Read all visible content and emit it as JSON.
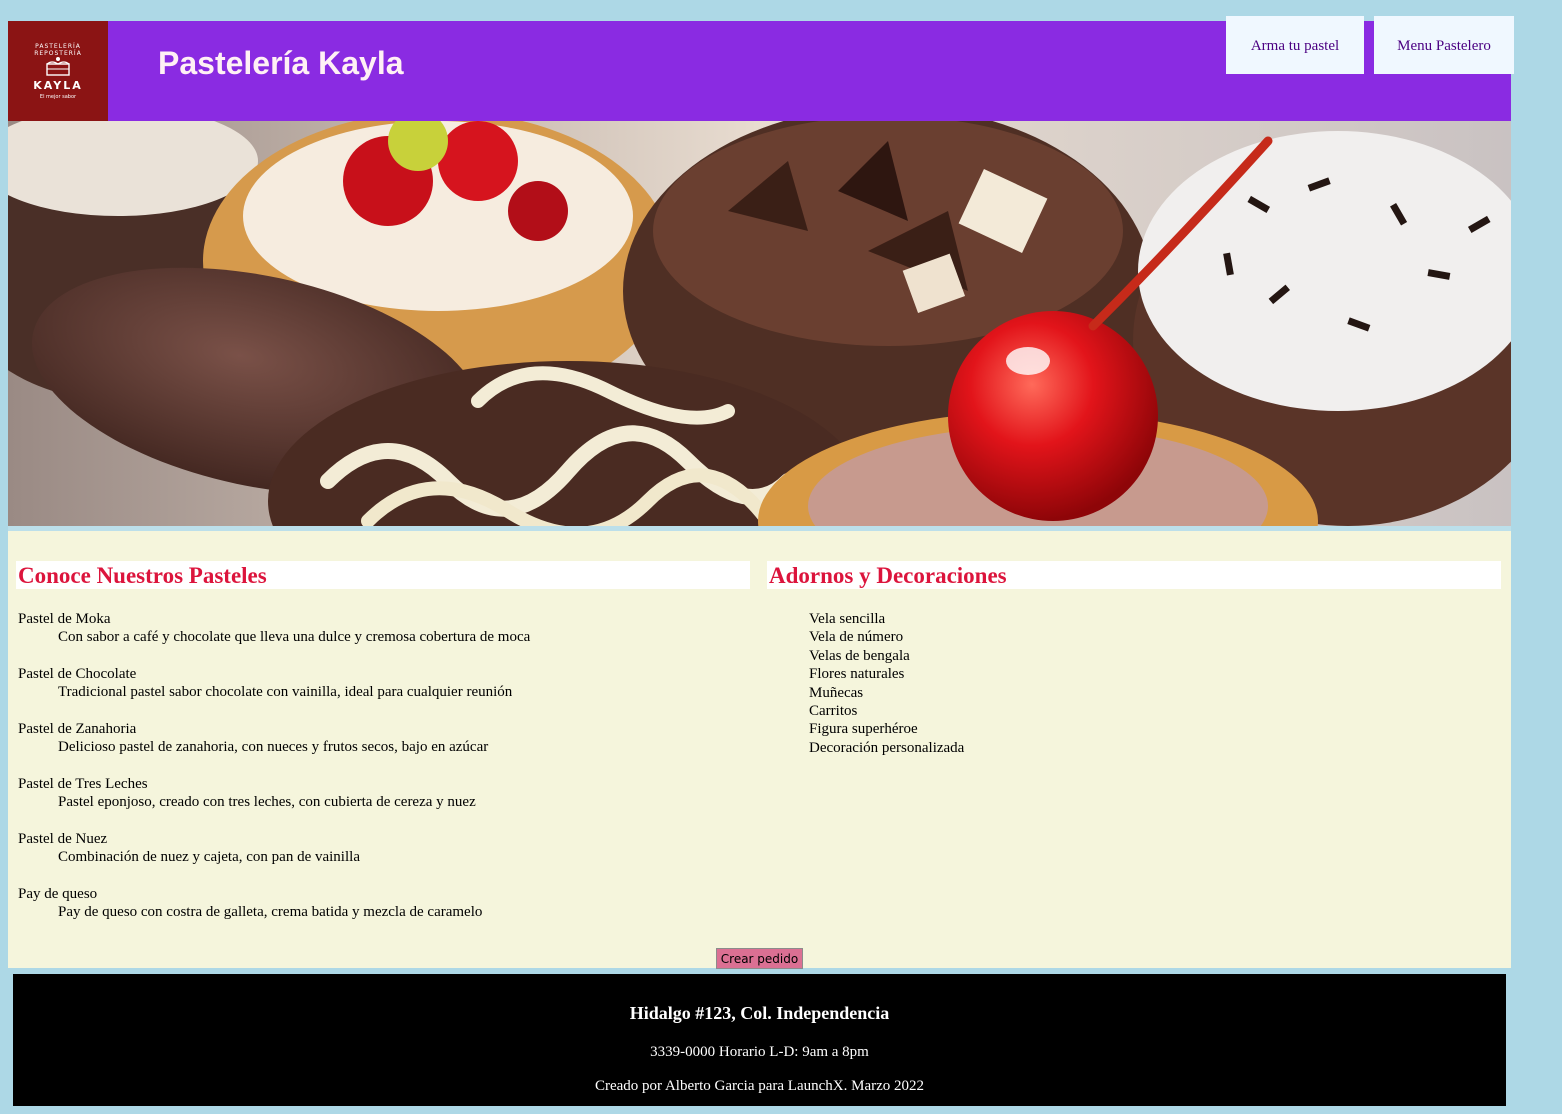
{
  "header": {
    "title": "Pastelería Kayla",
    "logo": {
      "arc_text": "PASTELERÍA REPOSTERÍA",
      "brand": "KAYLA",
      "slogan": "El mejor sabor",
      "icon": "cake-icon",
      "background": "#8b1414"
    },
    "nav": [
      {
        "label": "Arma tu pastel"
      },
      {
        "label": "Menu Pastelero"
      }
    ],
    "background": "#8a2be2"
  },
  "hero": {
    "image": "pastries-photo",
    "description_icons": [
      "chocolate-tart",
      "cherry-tart",
      "berry-tart",
      "cookies-cream-tart"
    ]
  },
  "main": {
    "background": "#f5f5dc",
    "cakes": {
      "title": "Conoce Nuestros Pasteles",
      "items": [
        {
          "name": "Pastel de Moka",
          "description": "Con sabor a café y chocolate que lleva una dulce y cremosa cobertura de moca"
        },
        {
          "name": "Pastel de Chocolate",
          "description": "Tradicional pastel sabor chocolate con vainilla, ideal para cualquier reunión"
        },
        {
          "name": "Pastel de Zanahoria",
          "description": "Delicioso pastel de zanahoria, con nueces y frutos secos, bajo en azúcar"
        },
        {
          "name": "Pastel de Tres Leches",
          "description": "Pastel eponjoso, creado con tres leches, con cubierta de cereza y nuez"
        },
        {
          "name": "Pastel de Nuez",
          "description": "Combinación de nuez y cajeta, con pan de vainilla"
        },
        {
          "name": "Pay de queso",
          "description": "Pay de queso con costra de galleta, crema batida y mezcla de caramelo"
        }
      ]
    },
    "decorations": {
      "title": "Adornos y Decoraciones",
      "items": [
        "Vela sencilla",
        "Vela de número",
        "Velas de bengala",
        "Flores naturales",
        "Muñecas",
        "Carritos",
        "Figura superhéroe",
        "Decoración personalizada"
      ]
    },
    "order_button": "Crear pedido",
    "title_color": "#dc143c"
  },
  "footer": {
    "address": "Hidalgo #123, Col. Independencia",
    "phone_hours": "3339-0000 Horario L-D: 9am a 8pm",
    "credit": "Creado por Alberto Garcia para LaunchX. Marzo 2022"
  }
}
